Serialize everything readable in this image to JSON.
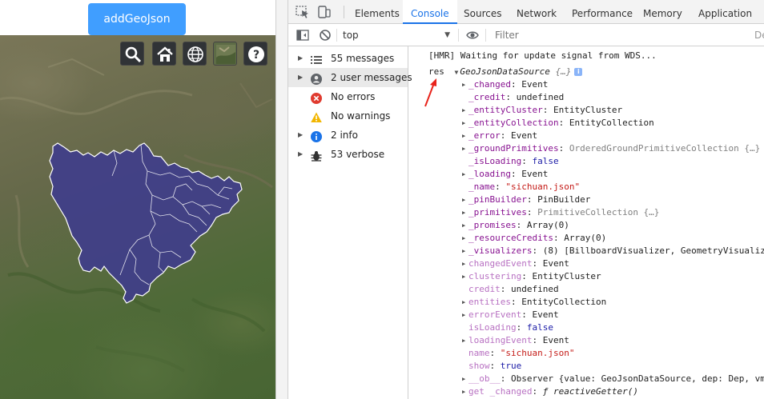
{
  "app": {
    "button_label": "addGeoJson",
    "map_tools": [
      {
        "icon": "search-icon"
      },
      {
        "icon": "home-icon"
      },
      {
        "icon": "globe-icon"
      },
      {
        "icon": "imagery-layer-icon"
      },
      {
        "icon": "help-icon"
      }
    ],
    "province_fill": "#3f3d8c",
    "province_stroke": "#ffffff"
  },
  "devtools": {
    "tabs": [
      "Elements",
      "Console",
      "Sources",
      "Network",
      "Performance",
      "Memory",
      "Application"
    ],
    "active_tab": "Console",
    "accent": "#1a73e8",
    "context": "top",
    "filter_placeholder": "Filter",
    "levels_cut": "De",
    "sidebar": [
      {
        "label": "55 messages",
        "icon": "list-icon",
        "expandable": true
      },
      {
        "label": "2 user messages",
        "icon": "user-icon",
        "expandable": true,
        "selected": true
      },
      {
        "label": "No errors",
        "icon": "error-icon",
        "expandable": false
      },
      {
        "label": "No warnings",
        "icon": "warning-icon",
        "expandable": false
      },
      {
        "label": "2 info",
        "icon": "info-icon",
        "expandable": true
      },
      {
        "label": "53 verbose",
        "icon": "bug-icon",
        "expandable": true
      }
    ],
    "console": {
      "hmr_line": "[HMR] Waiting for update signal from WDS...",
      "log_label": "res",
      "object_name": "GeoJsonDataSource",
      "object_hint": "{…}",
      "properties": [
        {
          "key": "_changed",
          "value": "Event",
          "expandable": true,
          "kind": "plain"
        },
        {
          "key": "_credit",
          "value": "undefined",
          "expandable": false,
          "kind": "plain"
        },
        {
          "key": "_entityCluster",
          "value": "EntityCluster",
          "expandable": true,
          "kind": "plain"
        },
        {
          "key": "_entityCollection",
          "value": "EntityCollection",
          "expandable": true,
          "kind": "plain"
        },
        {
          "key": "_error",
          "value": "Event",
          "expandable": true,
          "kind": "plain"
        },
        {
          "key": "_groundPrimitives",
          "value": "OrderedGroundPrimitiveCollection {…}",
          "expandable": true,
          "kind": "gray"
        },
        {
          "key": "_isLoading",
          "value": "false",
          "expandable": false,
          "kind": "bool"
        },
        {
          "key": "_loading",
          "value": "Event",
          "expandable": true,
          "kind": "plain"
        },
        {
          "key": "_name",
          "value": "\"sichuan.json\"",
          "expandable": false,
          "kind": "str"
        },
        {
          "key": "_pinBuilder",
          "value": "PinBuilder",
          "expandable": true,
          "kind": "plain"
        },
        {
          "key": "_primitives",
          "value": "PrimitiveCollection {…}",
          "expandable": true,
          "kind": "gray"
        },
        {
          "key": "_promises",
          "value": "Array(0)",
          "expandable": true,
          "kind": "plain"
        },
        {
          "key": "_resourceCredits",
          "value": "Array(0)",
          "expandable": true,
          "kind": "plain"
        },
        {
          "key": "_visualizers",
          "value": "(8) [BillboardVisualizer, GeometryVisualiz",
          "expandable": true,
          "kind": "plain"
        },
        {
          "key": "changedEvent",
          "value": "Event",
          "expandable": true,
          "kind": "plain",
          "dim": true
        },
        {
          "key": "clustering",
          "value": "EntityCluster",
          "expandable": true,
          "kind": "plain",
          "dim": true
        },
        {
          "key": "credit",
          "value": "undefined",
          "expandable": false,
          "kind": "plain",
          "dim": true
        },
        {
          "key": "entities",
          "value": "EntityCollection",
          "expandable": true,
          "kind": "plain",
          "dim": true
        },
        {
          "key": "errorEvent",
          "value": "Event",
          "expandable": true,
          "kind": "plain",
          "dim": true
        },
        {
          "key": "isLoading",
          "value": "false",
          "expandable": false,
          "kind": "bool",
          "dim": true
        },
        {
          "key": "loadingEvent",
          "value": "Event",
          "expandable": true,
          "kind": "plain",
          "dim": true
        },
        {
          "key": "name",
          "value": "\"sichuan.json\"",
          "expandable": false,
          "kind": "str",
          "dim": true
        },
        {
          "key": "show",
          "value": "true",
          "expandable": false,
          "kind": "bool",
          "dim": true
        },
        {
          "key": "__ob__",
          "value": "Observer {value: GeoJsonDataSource, dep: Dep, vm",
          "expandable": true,
          "kind": "plain",
          "dim": true
        },
        {
          "key": "get _changed",
          "value": "ƒ reactiveGetter()",
          "expandable": true,
          "kind": "italic",
          "dim": true
        }
      ]
    }
  }
}
